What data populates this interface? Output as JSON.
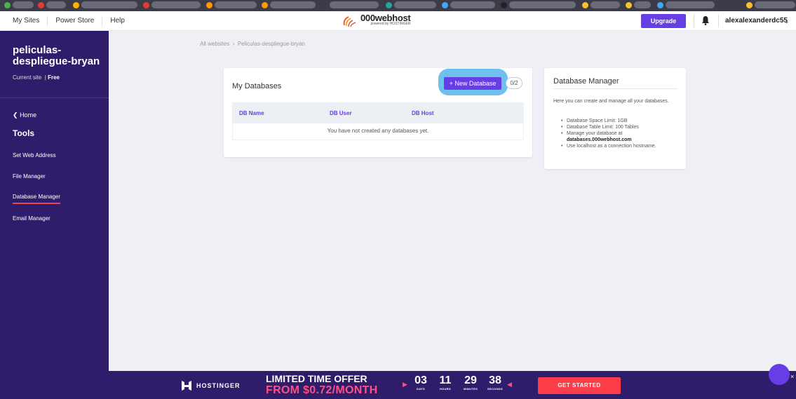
{
  "topbar": {
    "nav": [
      "My Sites",
      "Power Store",
      "Help"
    ],
    "brand": "000webhost",
    "powered": "powered by HOSTINGER",
    "upgrade": "Upgrade",
    "username": "alexalexanderdc55",
    "icons": [
      "bell-icon",
      "chevron-down-icon"
    ]
  },
  "sidebar": {
    "site_name": "peliculas-despliegue-bryan",
    "current_label": "Current site",
    "plan": "Free",
    "home": "Home",
    "tools": "Tools",
    "items": [
      "Set Web Address",
      "File Manager",
      "Database Manager",
      "Email Manager"
    ],
    "active_item": "Database Manager"
  },
  "breadcrumb": {
    "root": "All websites",
    "current": "Peliculas-despliegue-bryan"
  },
  "databases": {
    "title": "My Databases",
    "new_button": "+ New Database",
    "count": "0/2",
    "columns": [
      "DB Name",
      "DB User",
      "DB Host"
    ],
    "empty_message": "You have not created any databases yet."
  },
  "manager": {
    "title": "Database Manager",
    "intro": "Here you can create and manage all your databases.",
    "bullets": [
      "Database Space Limit: 1GB",
      "Database Table Limit: 100 Tables",
      "Manage your database at",
      "Use localhost as a connection hostname."
    ],
    "manage_link": "databases.000webhost.com"
  },
  "promo": {
    "brand": "HOSTINGER",
    "line1": "LIMITED TIME OFFER",
    "line2": "FROM $0.72/MONTH",
    "countdown": [
      {
        "value": "03",
        "label": "DAYS"
      },
      {
        "value": "11",
        "label": "HOURS"
      },
      {
        "value": "29",
        "label": "MINUTES"
      },
      {
        "value": "38",
        "label": "SECONDS"
      }
    ],
    "cta": "GET STARTED",
    "close": "×"
  },
  "colors": {
    "accent": "#673de6",
    "sidebar": "#2f1c6a",
    "promo_pink": "#fc5185",
    "cta_red": "#fc3d49",
    "highlight": "#6ec1ec",
    "active_underline": "#e5484d"
  }
}
